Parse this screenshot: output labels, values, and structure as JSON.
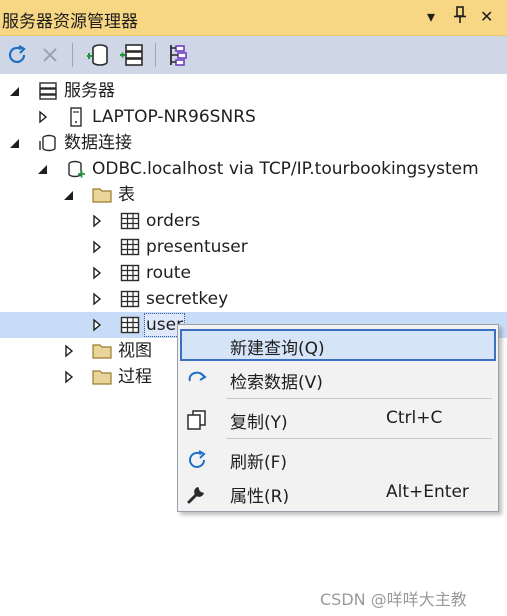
{
  "window": {
    "title": "服务器资源管理器",
    "dropdown_glyph": "▾",
    "pin_glyph": "⊥",
    "close_glyph": "✕"
  },
  "toolbar": {
    "tools": [
      "refresh-icon",
      "stop-icon",
      "connect-to-database-icon",
      "connect-to-server-icon",
      "sharepoint-icon"
    ]
  },
  "tree": {
    "servers": "服务器",
    "server_machine": "LAPTOP-NR96SNRS",
    "data_connections": "数据连接",
    "connection": "ODBC.localhost via TCP/IP.tourbookingsystem",
    "tables_folder": "表",
    "tables": [
      "orders",
      "presentuser",
      "route",
      "secretkey",
      "user"
    ],
    "views_folder": "视图",
    "procedures_folder": "过程"
  },
  "context_menu": {
    "new_query": "新建查询(Q)",
    "retrieve_data": "检索数据(V)",
    "copy": "复制(Y)",
    "copy_shortcut": "Ctrl+C",
    "refresh": "刷新(F)",
    "properties": "属性(R)",
    "properties_shortcut": "Alt+Enter"
  },
  "watermark": "CSDN @咩咩大主教",
  "colors": {
    "title_bg": "#f7d684",
    "toolbar_bg": "#cfd6e5",
    "selection_bg": "#c9dcf7",
    "menu_highlight_border": "#3a6fc2",
    "icon_blue": "#1f6fc5"
  }
}
